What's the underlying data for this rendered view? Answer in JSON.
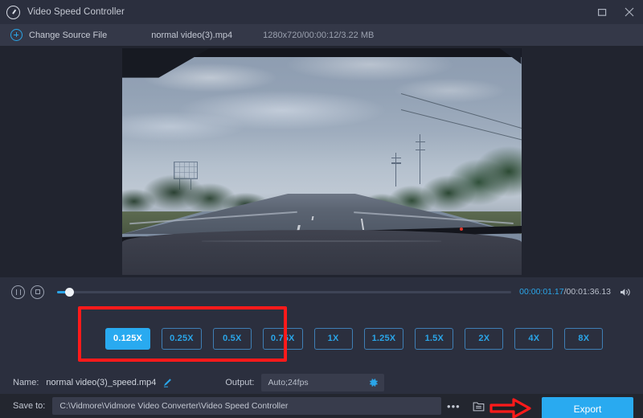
{
  "window": {
    "title": "Video Speed Controller",
    "app_icon": "speedometer-icon",
    "maximize_icon": "maximize-icon",
    "close_icon": "close-icon"
  },
  "source_bar": {
    "add_icon": "plus-circle-icon",
    "change_source_label": "Change Source File",
    "filename": "normal video(3).mp4",
    "meta": "1280x720/00:00:12/3.22 MB"
  },
  "player": {
    "pause_icon": "pause-icon",
    "stop_icon": "stop-icon",
    "progress_percent": 2.3,
    "current_time": "00:00:01.17",
    "separator": "/",
    "total_time": "00:01:36.13",
    "volume_icon": "volume-icon"
  },
  "speed": {
    "selected": "0.125X",
    "options": [
      {
        "label": "0.125X",
        "active": true
      },
      {
        "label": "0.25X",
        "active": false
      },
      {
        "label": "0.5X",
        "active": false
      },
      {
        "label": "0.75X",
        "active": false
      },
      {
        "label": "1X",
        "active": false
      },
      {
        "label": "1.25X",
        "active": false
      },
      {
        "label": "1.5X",
        "active": false
      },
      {
        "label": "2X",
        "active": false
      },
      {
        "label": "4X",
        "active": false
      },
      {
        "label": "8X",
        "active": false
      }
    ]
  },
  "output": {
    "name_label": "Name:",
    "name_value": "normal video(3)_speed.mp4",
    "edit_icon": "pencil-icon",
    "output_label": "Output:",
    "output_value": "Auto;24fps",
    "settings_icon": "gear-icon",
    "save_to_label": "Save to:",
    "save_to_path": "C:\\Vidmore\\Vidmore Video Converter\\Video Speed Controller",
    "browse_label": "•••",
    "folder_icon": "folder-icon",
    "export_label": "Export"
  },
  "annotations": {
    "highlight_color": "#ff1a1a",
    "arrow_target": "export-button",
    "box_target": "speed-options-0.125X-to-0.75X"
  },
  "colors": {
    "accent": "#29aaf0",
    "window_bg": "#2b2f3e",
    "source_bar_bg": "#343848",
    "video_bg": "#21242f",
    "footer_bg": "#23262f",
    "annotation_red": "#ff1a1a"
  }
}
